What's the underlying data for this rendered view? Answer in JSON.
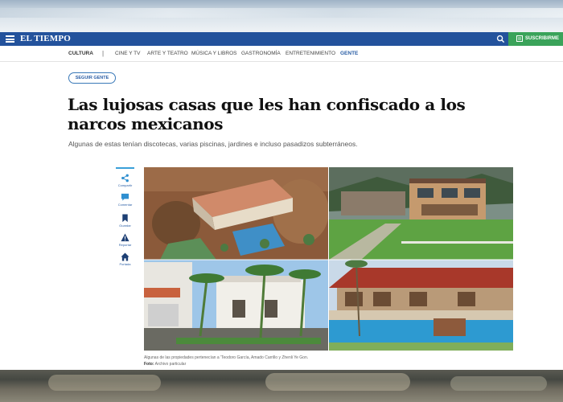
{
  "header": {
    "logo": "EL TIEMPO",
    "subscribe_label": "SUSCRIBIRME",
    "brand_color": "#23529c",
    "subscribe_color": "#3aa35a"
  },
  "nav": {
    "section": "CULTURA",
    "items": [
      "CINE Y TV",
      "ARTE Y TEATRO",
      "MÚSICA Y LIBROS",
      "GASTRONOMÍA",
      "ENTRETENIMIENTO",
      "GENTE"
    ],
    "active": "GENTE"
  },
  "article": {
    "follow_label": "SEGUIR GENTE",
    "headline": "Las lujosas casas que les han confiscado a los narcos mexicanos",
    "subhead": "Algunas de estas tenían discotecas, varias piscinas, jardines e incluso pasadizos subterráneos.",
    "caption": "Algunas de las propiedades pertenecían a 'Teodoro García, Amado Carrillo y Zhenli Ye Gon.",
    "credit_label": "Foto:",
    "credit_value": "Archivo particular"
  },
  "share_bar": [
    {
      "label": "Compartir",
      "icon": "share-icon"
    },
    {
      "label": "Comentar",
      "icon": "comment-icon"
    },
    {
      "label": "Guardar",
      "icon": "bookmark-icon"
    },
    {
      "label": "Reportar",
      "icon": "alert-icon"
    },
    {
      "label": "Portada",
      "icon": "home-icon"
    }
  ]
}
